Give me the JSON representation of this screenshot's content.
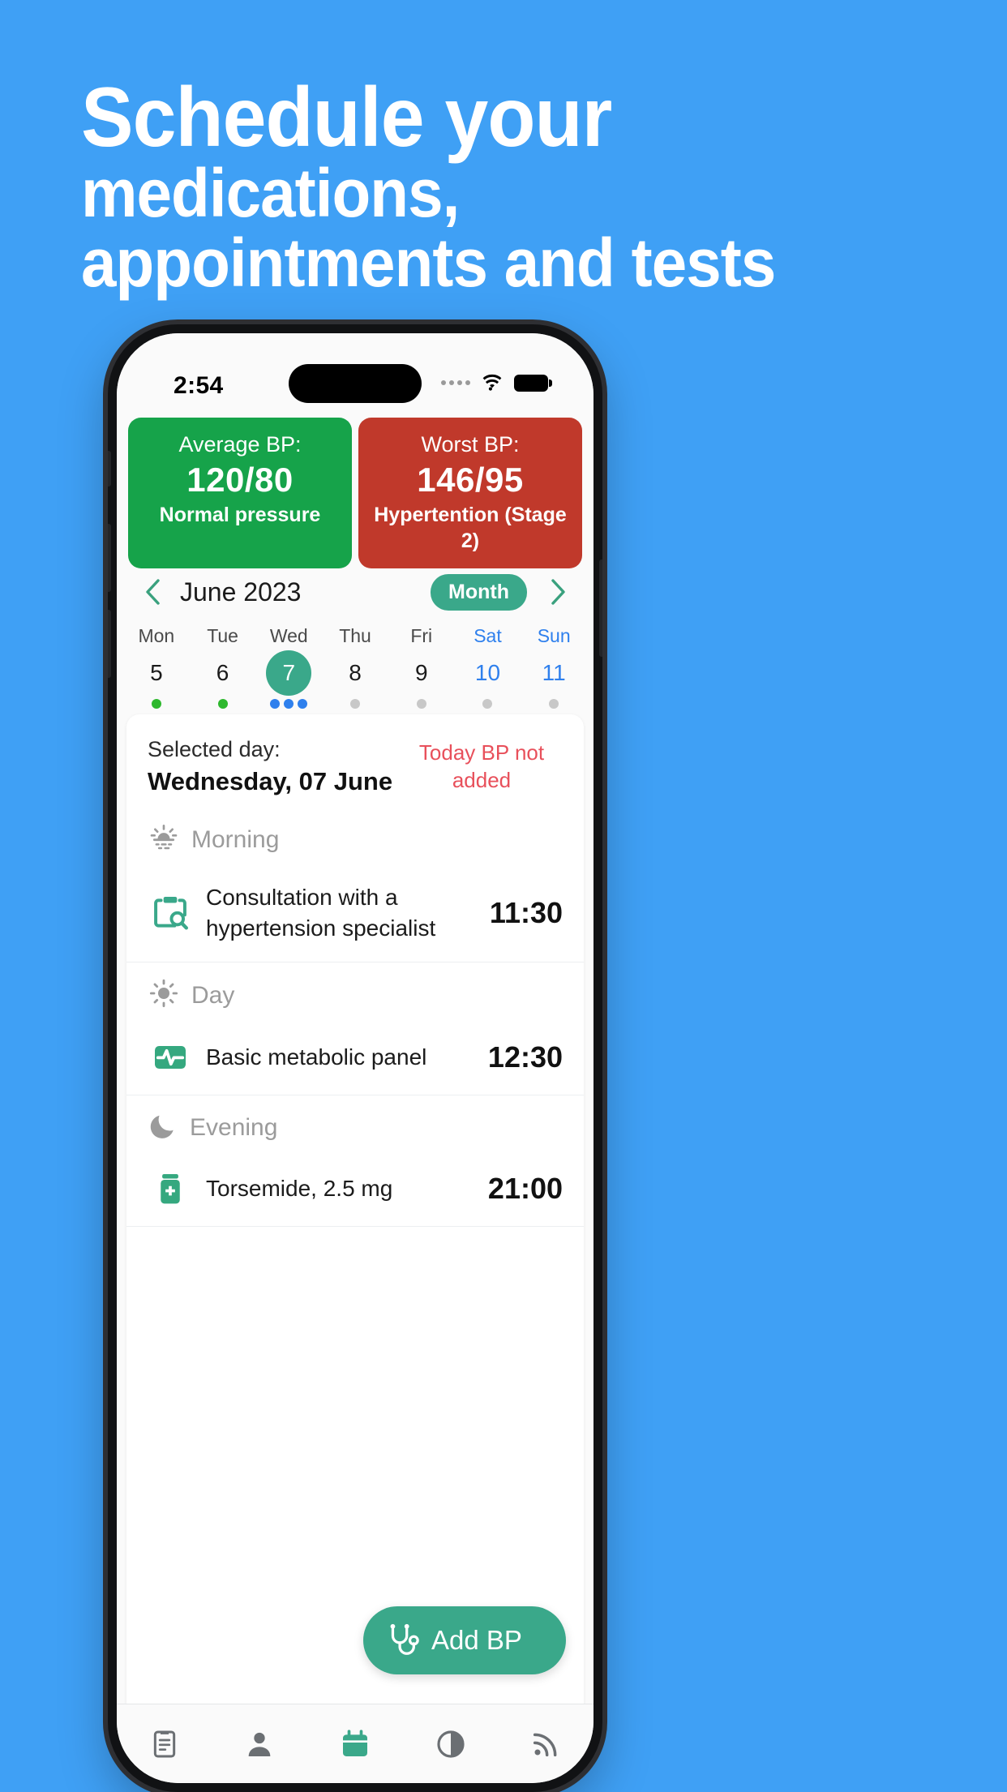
{
  "marketing": {
    "headline_line1": "Schedule your",
    "headline_line2": "medications,",
    "headline_line3": "appointments and tests",
    "background_color": "#3fa0f5"
  },
  "status_bar": {
    "time": "2:54",
    "wifi_icon": "wifi-icon",
    "battery_icon": "battery-icon",
    "signal_icon": "signal-dots-icon"
  },
  "bp_cards": [
    {
      "title": "Average BP:",
      "value": "120/80",
      "subtitle": "Normal pressure",
      "color": "#16a34a"
    },
    {
      "title": "Worst BP:",
      "value": "146/95",
      "subtitle": "Hypertention (Stage 2)",
      "color": "#c0392b"
    }
  ],
  "calendar": {
    "prev_icon": "chevron-left-icon",
    "next_icon": "chevron-right-icon",
    "month_label": "June 2023",
    "view_toggle": "Month",
    "accent_color": "#3aa88a",
    "days": [
      {
        "name": "Mon",
        "num": "5",
        "weekend": false,
        "selected": false,
        "dots": [
          "#2eb82e"
        ]
      },
      {
        "name": "Tue",
        "num": "6",
        "weekend": false,
        "selected": false,
        "dots": [
          "#2eb82e"
        ]
      },
      {
        "name": "Wed",
        "num": "7",
        "weekend": false,
        "selected": true,
        "dots": [
          "#2f80ed",
          "#2f80ed",
          "#2f80ed"
        ]
      },
      {
        "name": "Thu",
        "num": "8",
        "weekend": false,
        "selected": false,
        "dots": [
          "#c8c8c8"
        ]
      },
      {
        "name": "Fri",
        "num": "9",
        "weekend": false,
        "selected": false,
        "dots": [
          "#c8c8c8"
        ]
      },
      {
        "name": "Sat",
        "num": "10",
        "weekend": true,
        "selected": false,
        "dots": [
          "#c8c8c8"
        ]
      },
      {
        "name": "Sun",
        "num": "11",
        "weekend": true,
        "selected": false,
        "dots": [
          "#c8c8c8"
        ]
      }
    ]
  },
  "day_card": {
    "selected_label": "Selected day:",
    "selected_date": "Wednesday, 07 June",
    "bp_warning": "Today BP not added",
    "warning_color": "#e8505b",
    "sections": [
      {
        "label": "Morning",
        "icon": "sunrise-icon",
        "events": [
          {
            "title": "Consultation with a hypertension specialist",
            "time": "11:30",
            "icon": "clipboard-search-icon"
          }
        ]
      },
      {
        "label": "Day",
        "icon": "sun-icon",
        "events": [
          {
            "title": "Basic metabolic panel",
            "time": "12:30",
            "icon": "pulse-square-icon"
          }
        ]
      },
      {
        "label": "Evening",
        "icon": "moon-icon",
        "events": [
          {
            "title": "Torsemide, 2.5 mg",
            "time": "21:00",
            "icon": "pill-bottle-icon"
          }
        ]
      }
    ],
    "fab": {
      "label": "Add BP",
      "icon": "stethoscope-icon",
      "color": "#3aa88a"
    }
  },
  "tab_bar": {
    "items": [
      {
        "icon": "clipboard-list-icon",
        "active": false
      },
      {
        "icon": "person-icon",
        "active": false
      },
      {
        "icon": "calendar-icon",
        "active": true
      },
      {
        "icon": "pie-chart-icon",
        "active": false
      },
      {
        "icon": "feed-icon",
        "active": false
      }
    ],
    "active_color": "#3aa88a",
    "inactive_color": "#6b6f73"
  }
}
